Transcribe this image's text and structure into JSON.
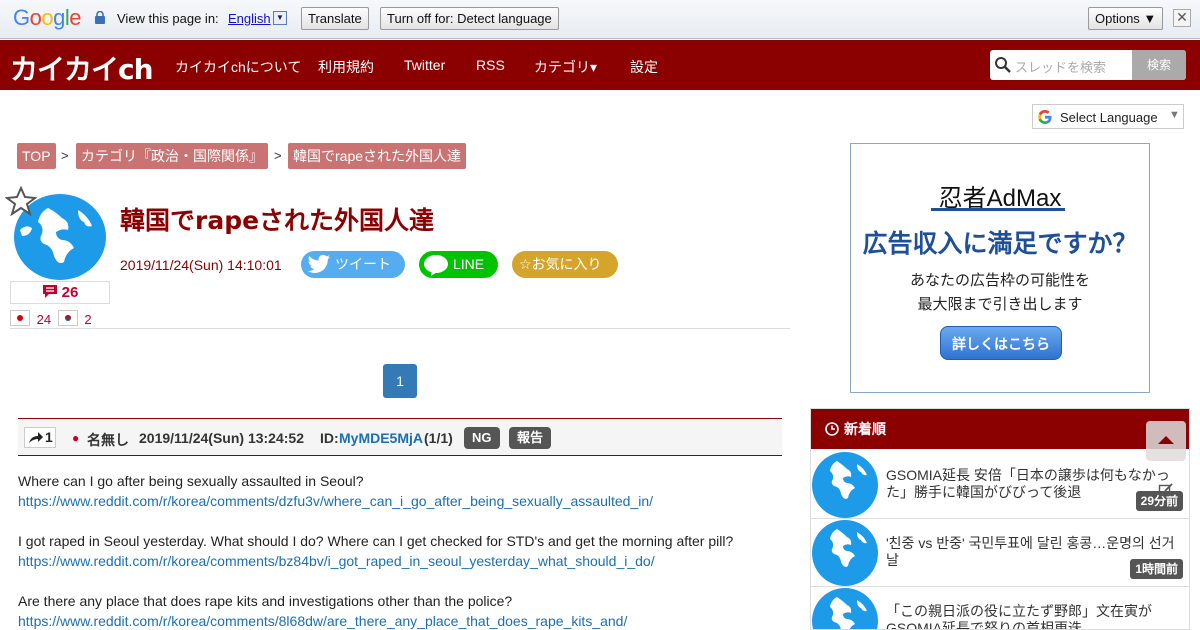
{
  "translate_bar": {
    "logo": "Google",
    "view_text": "View this page in:",
    "language": "English",
    "translate_button": "Translate",
    "turn_off_button": "Turn off for: Detect language",
    "options_button": "Options ▼",
    "close": "✕"
  },
  "header": {
    "logo": "カイカイch",
    "nav": [
      "カイカイchについて",
      "利用規約",
      "Twitter",
      "RSS",
      "カテゴリ▾",
      "設定"
    ],
    "search_placeholder": "スレッドを検索",
    "search_button": "検索"
  },
  "select_language": "Select Language",
  "breadcrumb": [
    "TOP",
    "カテゴリ『政治・国際関係』",
    "韓国でrapeされた外国人達"
  ],
  "thread": {
    "title": "韓国でrapeされた外国人達",
    "date": "2019/11/24(Sun) 14:10:01",
    "tweet": "ツイート",
    "line": "LINE",
    "favorite": "☆お気に入り",
    "comment_count": "26",
    "jp_count": "24",
    "kr_count": "2"
  },
  "pagination": {
    "current": "1"
  },
  "post": {
    "number": "1",
    "name": "名無し",
    "date": "2019/11/24(Sun) 13:24:52",
    "id_label": "ID:",
    "id": "MyMDE5MjA",
    "id_count": "(1/1)",
    "ng": "NG",
    "report": "報告",
    "paragraphs": [
      {
        "text": "Where can I go after being sexually assaulted in Seoul?",
        "link": "https://www.reddit.com/r/korea/comments/dzfu3v/where_can_i_go_after_being_sexually_assaulted_in/"
      },
      {
        "text": "I got raped in Seoul yesterday. What should I do? Where can I get checked for STD's and get the morning after pill?",
        "link": "https://www.reddit.com/r/korea/comments/bz84bv/i_got_raped_in_seoul_yesterday_what_should_i_do/"
      },
      {
        "text": "Are there any place that does rape kits and investigations other than the police?",
        "link": "https://www.reddit.com/r/korea/comments/8l68dw/are_there_any_place_that_does_rape_kits_and/"
      }
    ]
  },
  "ad": {
    "brand": "忍者AdMax",
    "headline": "広告収入に満足ですか？",
    "line1": "あなたの広告枠の可能性を",
    "line2": "最大限まで引き出します",
    "cta": "詳しくはこちら"
  },
  "new_threads": {
    "heading": "新着順",
    "items": [
      {
        "title": "GSOMIA延長 安倍「日本の譲歩は何もなかった」勝手に韓国がびびって後退",
        "ago": "29分前"
      },
      {
        "title": "'친중 vs 반중' 국민투표에 달린 홍콩…운명의 선거날",
        "ago": "1時間前"
      },
      {
        "title": "「この親日派の役に立たず野郎」文在寅がGSOMIA延長で怒りの首相更迭",
        "ago": ""
      }
    ]
  },
  "colors": {
    "brand": "#8b0000",
    "link": "#1a6fb5",
    "accent": "#337ab7"
  }
}
